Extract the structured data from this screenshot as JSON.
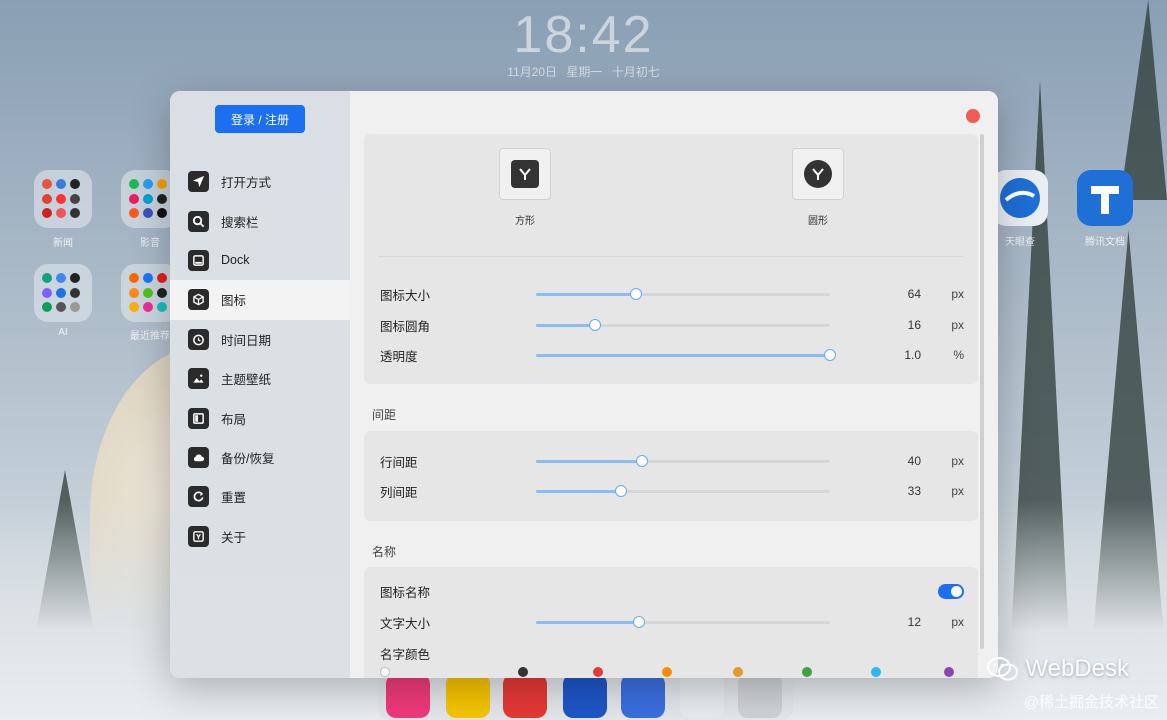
{
  "lockscreen": {
    "time": "18:42",
    "date": "11月20日  星期一  十月初七"
  },
  "desktop": {
    "folders": [
      {
        "label": "新闻"
      },
      {
        "label": "影音"
      },
      {
        "label": "AI"
      },
      {
        "label": "最近推荐"
      }
    ],
    "apps": [
      {
        "label": "天眼查"
      },
      {
        "label": "腾讯文档"
      }
    ]
  },
  "sidebar": {
    "login_label": "登录 / 注册",
    "items": [
      {
        "label": "打开方式",
        "icon": "send-icon"
      },
      {
        "label": "搜索栏",
        "icon": "search-icon"
      },
      {
        "label": "Dock",
        "icon": "dock-icon"
      },
      {
        "label": "图标",
        "icon": "cube-icon",
        "active": true
      },
      {
        "label": "时间日期",
        "icon": "clock-icon"
      },
      {
        "label": "主题壁纸",
        "icon": "image-icon"
      },
      {
        "label": "布局",
        "icon": "layout-icon"
      },
      {
        "label": "备份/恢复",
        "icon": "cloud-icon"
      },
      {
        "label": "重置",
        "icon": "reset-icon"
      },
      {
        "label": "关于",
        "icon": "about-icon"
      }
    ]
  },
  "icon_settings": {
    "shapes": [
      {
        "label": "方形",
        "selected": true
      },
      {
        "label": "圆形",
        "selected": false
      }
    ],
    "rows": [
      {
        "label": "图标大小",
        "value": "64",
        "unit": "px",
        "fraction": 0.34
      },
      {
        "label": "图标圆角",
        "value": "16",
        "unit": "px",
        "fraction": 0.2
      },
      {
        "label": "透明度",
        "value": "1.0",
        "unit": "%",
        "fraction": 1.0
      }
    ]
  },
  "spacing": {
    "title": "间距",
    "rows": [
      {
        "label": "行间距",
        "value": "40",
        "unit": "px",
        "fraction": 0.36
      },
      {
        "label": "列间距",
        "value": "33",
        "unit": "px",
        "fraction": 0.29
      }
    ]
  },
  "name": {
    "title": "名称",
    "show_label": "图标名称",
    "show_enabled": true,
    "font_size": {
      "label": "文字大小",
      "value": "12",
      "unit": "px",
      "fraction": 0.35
    },
    "color_label": "名字颜色",
    "colors": [
      "#ffffff",
      "#333333",
      "#e53935",
      "#fb8c00",
      "#e59a2a",
      "#43a047",
      "#29b6f6",
      "#8e44ad"
    ]
  },
  "watermark": {
    "brand": "WebDesk",
    "credit": "@稀土掘金技术社区"
  },
  "colors": {
    "accent": "#1b6ff0",
    "close": "#f45b52",
    "slider": "#8bbcf5"
  }
}
